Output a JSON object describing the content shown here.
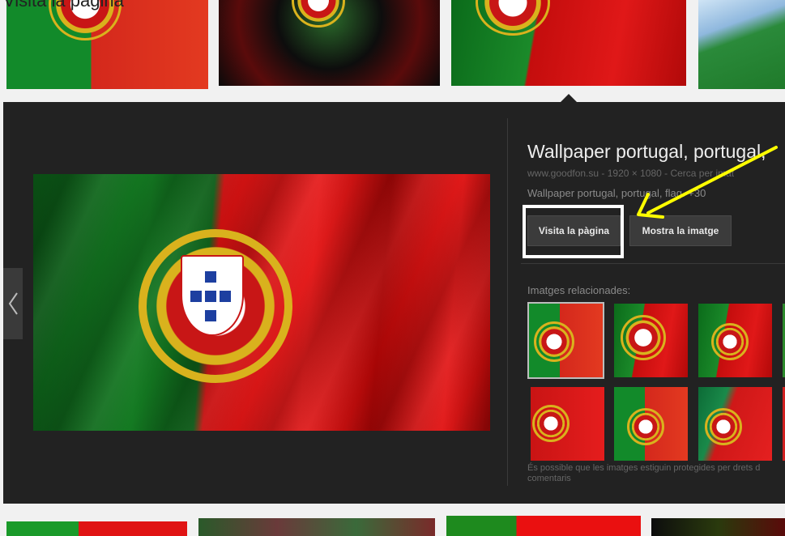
{
  "page": {
    "caption_top": "Visita la pàgina"
  },
  "detail": {
    "title": "Wallpaper portugal, portugal,",
    "meta": "www.goodfon.su - 1920 × 1080 - Cerca per imat",
    "description": "Wallpaper portugal, portugal, flag. +30",
    "visit_button": "Visita la pàgina",
    "view_button": "Mostra la imatge",
    "related_label": "Imatges relacionades:",
    "copyright_note": "És possible que les imatges estiguin protegides per drets d",
    "comments_link": "comentaris"
  },
  "icons": {
    "prev": "chevron-left-icon",
    "annotation": "yellow-arrow-annotation"
  },
  "colors": {
    "panel_bg": "#222222",
    "highlight": "#ffffff",
    "annotation": "#ffff00",
    "green": "#128a2a",
    "red": "#d4281c"
  }
}
